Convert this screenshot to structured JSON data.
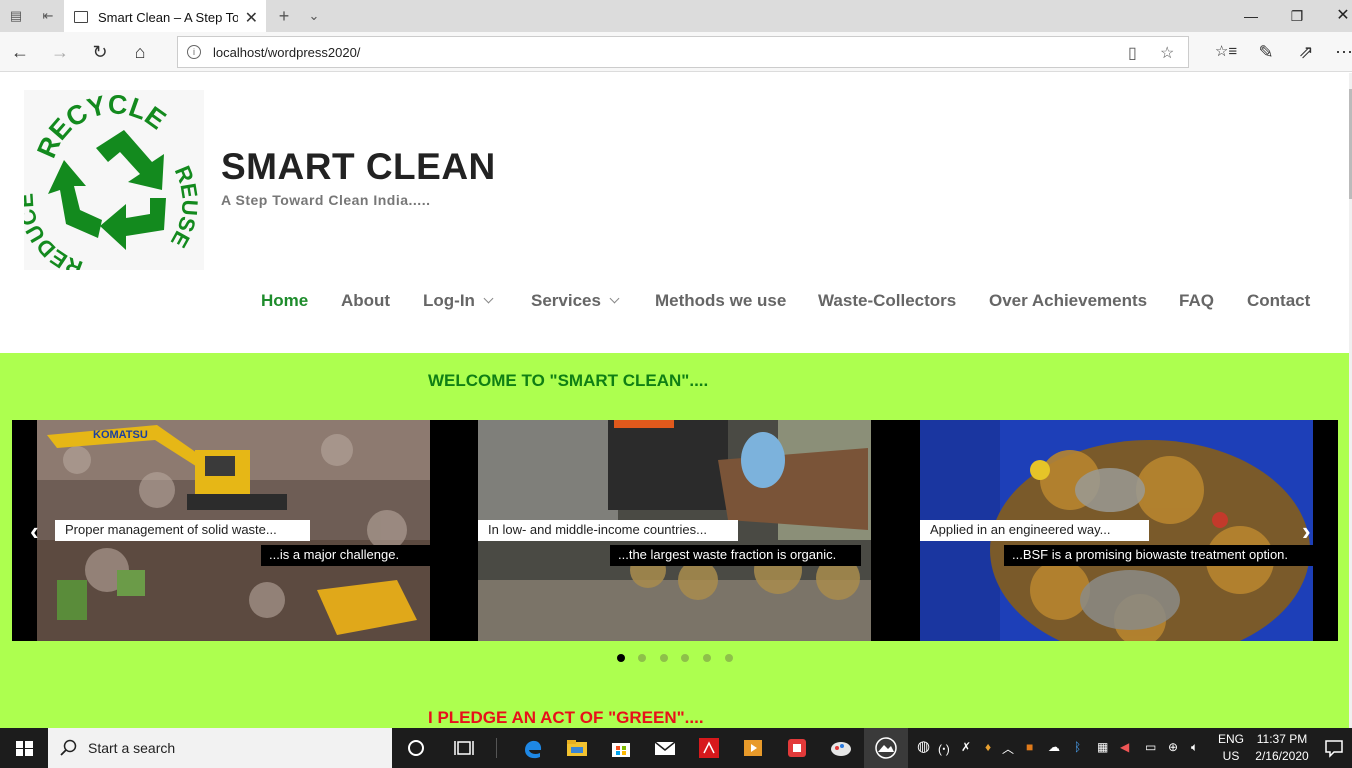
{
  "browser": {
    "tab_title": "Smart Clean – A Step To",
    "url": "localhost/wordpress2020/",
    "window_controls": [
      "minimize-icon",
      "restore-icon",
      "close-icon"
    ]
  },
  "site": {
    "logo_text": [
      "RECYCLE",
      "REUSE",
      "REDUCE"
    ],
    "title": "SMART CLEAN",
    "description": "A Step Toward Clean India.....",
    "menu": [
      "Home",
      "About",
      "Log-In",
      "Services",
      "Methods we use",
      "Waste-Collectors",
      "Over Achievements",
      "FAQ",
      "Contact"
    ],
    "active_menu": "Home",
    "welcome": "WELCOME TO \"SMART CLEAN\"....",
    "pledge": "I PLEDGE AN ACT OF \"GREEN\"....",
    "accent_green": "#1e8c2c",
    "band_color": "#adff4f"
  },
  "slides": [
    {
      "caption_top": "Proper management of solid waste...",
      "caption_bottom": "...is a major challenge.",
      "banner": "KOMATSU"
    },
    {
      "caption_top": "In low- and middle-income countries...",
      "caption_bottom": "...the largest waste fraction is organic."
    },
    {
      "caption_top": "Applied in an engineered way...",
      "caption_bottom": "...BSF is a promising biowaste treatment option."
    }
  ],
  "slider": {
    "dot_count": 6,
    "active_dot": 1
  },
  "taskbar": {
    "search_placeholder": "Start a search",
    "lang_top": "ENG",
    "lang_bottom": "US",
    "time": "11:37 PM",
    "date": "2/16/2020"
  }
}
